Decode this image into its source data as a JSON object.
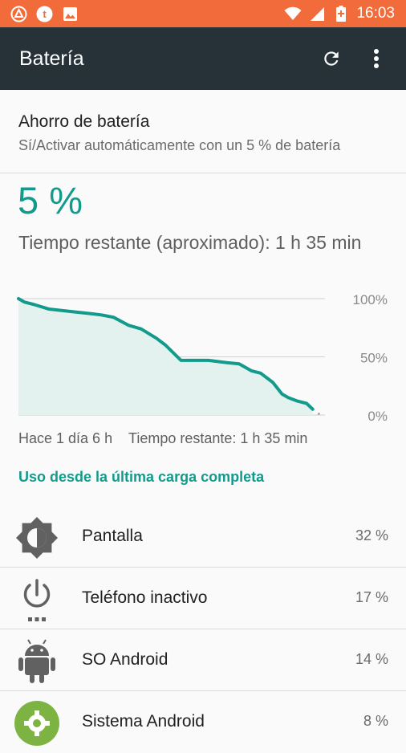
{
  "status_bar": {
    "time": "16:03",
    "icons_left": [
      "app-notification-icon",
      "t-notification-icon",
      "image-icon"
    ],
    "icons_right": [
      "wifi-icon",
      "signal-icon",
      "battery-alert-icon"
    ]
  },
  "appbar": {
    "title": "Batería",
    "actions": [
      "refresh-icon",
      "more-vert-icon"
    ]
  },
  "battery_saver": {
    "title": "Ahorro de batería",
    "summary": "Sí/Activar automáticamente con un 5 % de batería"
  },
  "battery": {
    "level": "5 %",
    "remaining": "Tiempo restante (aproximado): 1 h 35 min",
    "since_label": "Hace 1 día 6 h",
    "remaining_short": "Tiempo restante: 1 h 35 min"
  },
  "chart_data": {
    "type": "area",
    "ylim": [
      0,
      100
    ],
    "ytick_labels": [
      "100%",
      "50%",
      "0%"
    ],
    "x": [
      0,
      2,
      5,
      10,
      17,
      24,
      27,
      31,
      36,
      40,
      45,
      48,
      53,
      58,
      62,
      68,
      72,
      76,
      79,
      83,
      86,
      88,
      91,
      94,
      96
    ],
    "values": [
      100,
      97,
      95,
      91,
      89,
      87,
      86,
      84,
      77,
      74,
      66,
      60,
      47,
      47,
      47,
      45,
      44,
      38,
      36,
      28,
      18,
      15,
      12,
      10,
      5
    ],
    "projection_x": [
      98
    ],
    "projection_values": [
      1
    ],
    "grid": true,
    "line_color": "#129b8c",
    "fill_color": "#e4f2ef"
  },
  "usage": {
    "header": "Uso desde la última carga completa",
    "items": [
      {
        "name": "Pantalla",
        "percent": "32 %",
        "icon": "brightness-icon"
      },
      {
        "name": "Teléfono inactivo",
        "percent": "17 %",
        "icon": "power-idle-icon"
      },
      {
        "name": "SO Android",
        "percent": "14 %",
        "icon": "android-icon"
      },
      {
        "name": "Sistema Android",
        "percent": "8 %",
        "icon": "settings-gear-icon"
      }
    ]
  },
  "colors": {
    "status_bar": "#f26b3a",
    "app_bar": "#263238",
    "accent": "#129b8c"
  }
}
